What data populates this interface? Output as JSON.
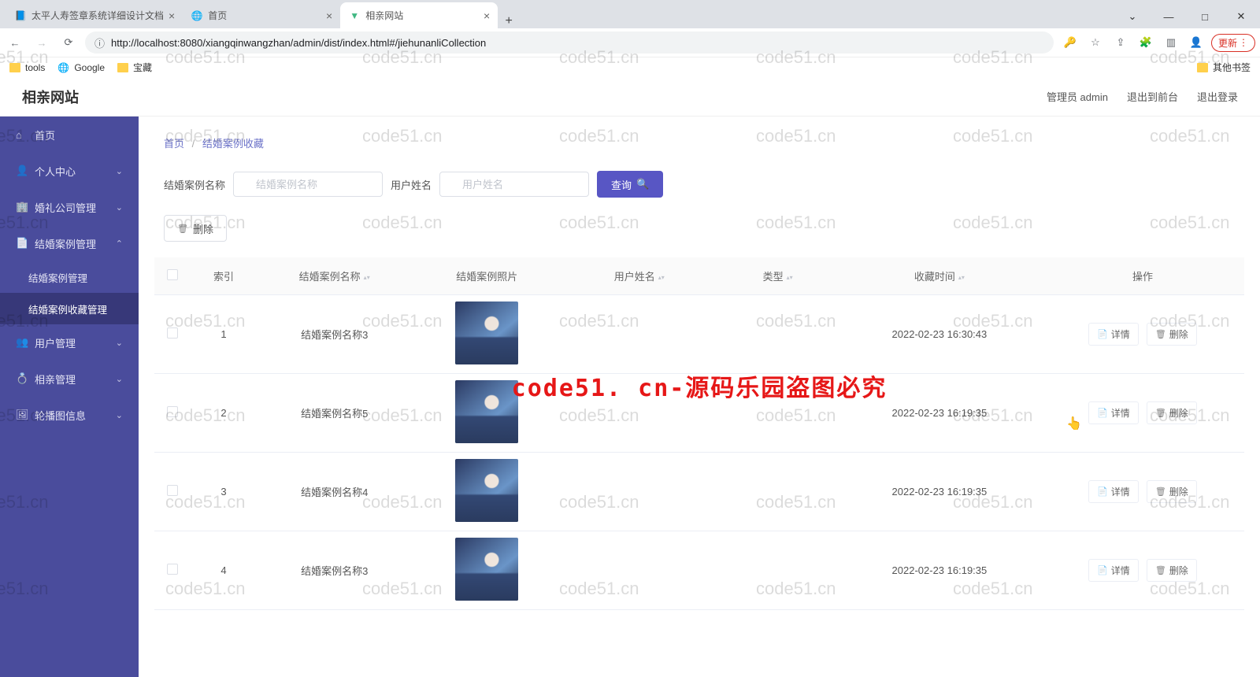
{
  "browser": {
    "tabs": [
      {
        "title": "太平人寿签章系统详细设计文档",
        "favicon": "📘",
        "active": false
      },
      {
        "title": "首页",
        "favicon": "🌐",
        "active": false
      },
      {
        "title": "相亲网站",
        "favicon": "▼",
        "active": true
      }
    ],
    "url": "http://localhost:8080/xiangqinwangzhan/admin/dist/index.html#/jiehunanliCollection",
    "update_label": "更新",
    "bookmarks": [
      {
        "label": "tools",
        "type": "folder"
      },
      {
        "label": "Google",
        "type": "globe"
      },
      {
        "label": "宝藏",
        "type": "folder"
      }
    ],
    "other_bookmarks": "其他书签"
  },
  "app": {
    "title": "相亲网站",
    "header": {
      "admin_label": "管理员 admin",
      "exit_front": "退出到前台",
      "logout": "退出登录"
    },
    "sidebar": [
      {
        "icon": "⌂",
        "label": "首页",
        "expandable": false
      },
      {
        "icon": "👤",
        "label": "个人中心",
        "expandable": true,
        "open": false
      },
      {
        "icon": "🏢",
        "label": "婚礼公司管理",
        "expandable": true,
        "open": false
      },
      {
        "icon": "📄",
        "label": "结婚案例管理",
        "expandable": true,
        "open": true,
        "children": [
          {
            "label": "结婚案例管理",
            "active": false
          },
          {
            "label": "结婚案例收藏管理",
            "active": true
          }
        ]
      },
      {
        "icon": "👥",
        "label": "用户管理",
        "expandable": true,
        "open": false
      },
      {
        "icon": "💍",
        "label": "相亲管理",
        "expandable": true,
        "open": false
      },
      {
        "icon": "🖼",
        "label": "轮播图信息",
        "expandable": true,
        "open": false
      }
    ],
    "breadcrumb": {
      "home": "首页",
      "current": "结婚案例收藏"
    },
    "filters": {
      "name_label": "结婚案例名称",
      "name_placeholder": "结婚案例名称",
      "user_label": "用户姓名",
      "user_placeholder": "用户姓名",
      "search_btn": "查询",
      "delete_btn": "删除"
    },
    "table": {
      "headers": {
        "index": "索引",
        "case_name": "结婚案例名称",
        "case_photo": "结婚案例照片",
        "user_name": "用户姓名",
        "type": "类型",
        "collect_time": "收藏时间",
        "actions": "操作"
      },
      "action_labels": {
        "detail": "详情",
        "delete": "删除"
      },
      "rows": [
        {
          "index": "1",
          "case_name": "结婚案例名称3",
          "user_name": "",
          "type": "",
          "collect_time": "2022-02-23 16:30:43"
        },
        {
          "index": "2",
          "case_name": "结婚案例名称5",
          "user_name": "",
          "type": "",
          "collect_time": "2022-02-23 16:19:35"
        },
        {
          "index": "3",
          "case_name": "结婚案例名称4",
          "user_name": "",
          "type": "",
          "collect_time": "2022-02-23 16:19:35"
        },
        {
          "index": "4",
          "case_name": "结婚案例名称3",
          "user_name": "",
          "type": "",
          "collect_time": "2022-02-23 16:19:35"
        }
      ]
    }
  },
  "watermark": {
    "grey": "code51.cn",
    "red": "code51. cn-源码乐园盗图必究"
  }
}
